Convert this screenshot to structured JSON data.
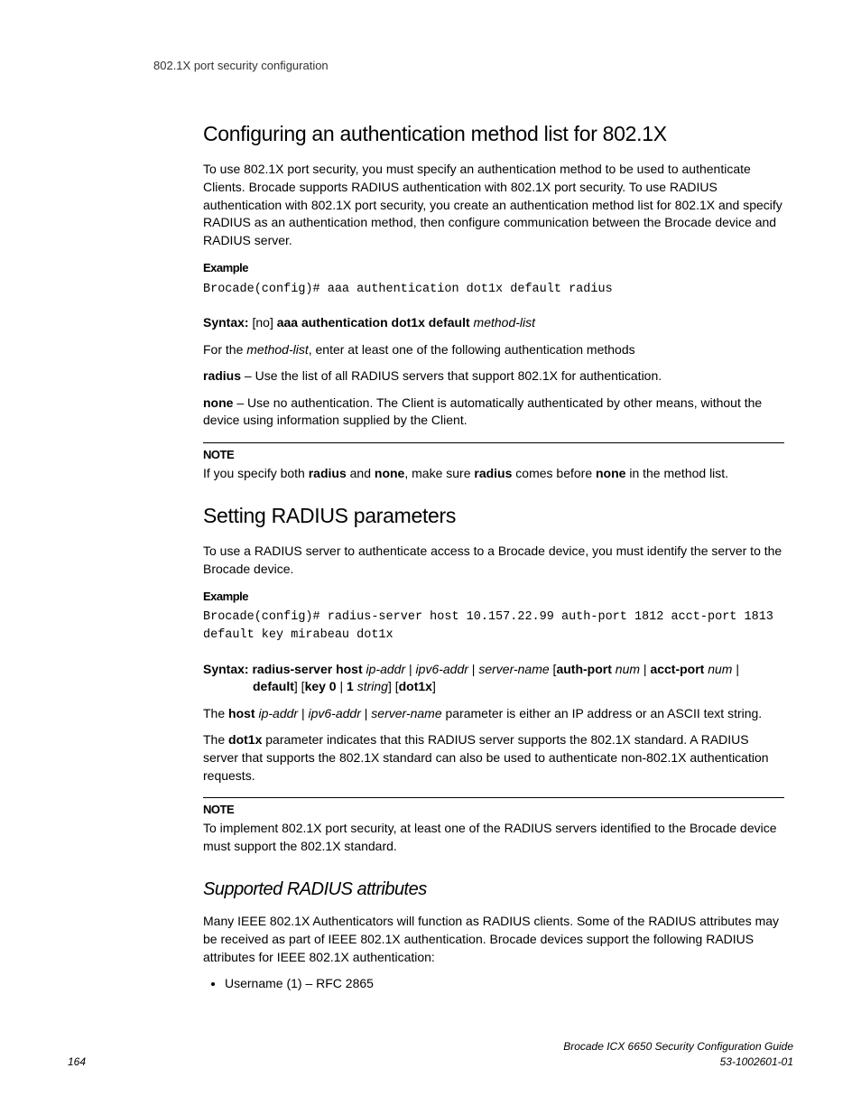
{
  "header": {
    "running_title": "802.1X port security configuration"
  },
  "sections": {
    "s1": {
      "heading": "Configuring an authentication method list for 802.1X",
      "intro": "To use 802.1X port security, you must specify an authentication method to be used to authenticate Clients. Brocade supports RADIUS authentication with 802.1X port security. To use RADIUS authentication with 802.1X port security, you create an authentication method list for 802.1X and specify RADIUS as an authentication method, then configure communication between the Brocade device and RADIUS server.",
      "example_label": "Example",
      "example_code": "Brocade(config)# aaa authentication dot1x default radius",
      "syntax": {
        "label": "Syntax:",
        "no": "no",
        "bold": "aaa authentication dot1x default",
        "italic": "method-list"
      },
      "method_list_intro_prefix": "For the ",
      "method_list_intro_italic": "method-list",
      "method_list_intro_suffix": ", enter at least one of the following authentication methods",
      "radius_label": "radius",
      "radius_desc": " – Use the list of all RADIUS servers that support 802.1X for authentication.",
      "none_label": "none",
      "none_desc": " – Use no authentication. The Client is automatically authenticated by other means, without the device using information supplied by the Client.",
      "note_label": "NOTE",
      "note": {
        "p1": "If you specify both ",
        "b1": "radius",
        "p2": " and ",
        "b2": "none",
        "p3": ", make sure ",
        "b3": "radius",
        "p4": " comes before ",
        "b4": "none",
        "p5": " in the method list."
      }
    },
    "s2": {
      "heading": "Setting RADIUS parameters",
      "intro": "To use a RADIUS server to authenticate access to a Brocade device, you must identify the server to the Brocade device.",
      "example_label": "Example",
      "example_code": "Brocade(config)# radius-server host 10.157.22.99 auth-port 1812 acct-port 1813 \ndefault key mirabeau dot1x",
      "syntax": {
        "label": "Syntax:",
        "b1": "radius-server host",
        "i1": "ip-addr",
        "sep1": " | ",
        "i2": "ipv6-addr",
        "sep2": " | ",
        "i3": "server-name",
        "lb1": " [",
        "b2": "auth-port",
        "sp1": " ",
        "i4": "num",
        "sep3": " | ",
        "b3": "acct-port",
        "sp2": " ",
        "i5": "num",
        "sep4": " | ",
        "b4": "default",
        "rb1": "]",
        "lb2": " [",
        "b5": "key 0",
        "sep5": " | ",
        "b6": "1",
        "sp3": " ",
        "i6": "string",
        "rb2": "]",
        "lb3": " [",
        "b7": "dot1x",
        "rb3": "]"
      },
      "host_desc": {
        "p1": "The ",
        "b1": "host",
        "sp": " ",
        "i1": "ip-addr",
        "sep1": " | ",
        "i2": "ipv6-addr",
        "sep2": " | ",
        "i3": "server-name",
        "p2": " parameter is either an IP address or an ASCII text string."
      },
      "dot1x_desc": {
        "p1": "The ",
        "b1": "dot1x",
        "p2": " parameter indicates that this RADIUS server supports the 802.1X standard.  A RADIUS server that supports the 802.1X standard can also be used to authenticate non-802.1X authentication requests."
      },
      "note_label": "NOTE",
      "note": "To implement 802.1X port security, at least one of the RADIUS servers identified to the Brocade device must support the 802.1X standard.",
      "sub": {
        "heading": "Supported RADIUS attributes",
        "intro": "Many IEEE 802.1X Authenticators will function as RADIUS clients. Some of the RADIUS attributes may be received as part of IEEE 802.1X authentication. Brocade devices support the following RADIUS attributes for IEEE 802.1X authentication:",
        "bullets": [
          "Username (1) – RFC 2865"
        ]
      }
    }
  },
  "footer": {
    "page_number": "164",
    "doc_title": "Brocade ICX 6650 Security Configuration Guide",
    "doc_number": "53-1002601-01"
  }
}
